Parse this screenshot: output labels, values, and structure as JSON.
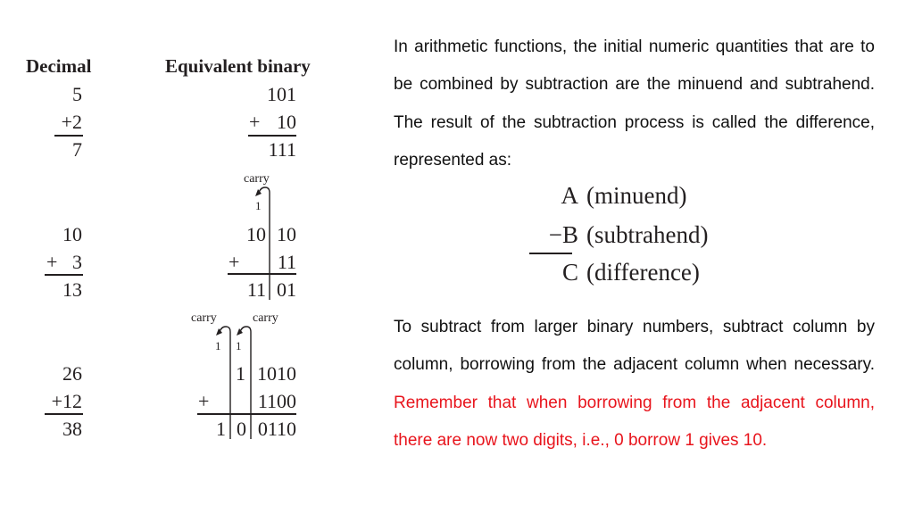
{
  "left_figure": {
    "headers": {
      "decimal": "Decimal",
      "binary": "Equivalent binary"
    },
    "examples": [
      {
        "decimal": {
          "a": "5",
          "b": "+2",
          "sum": "7"
        },
        "binary": {
          "a": "101",
          "op": "+",
          "b": "10",
          "sum": "111"
        }
      },
      {
        "decimal": {
          "a": "10",
          "op": "+",
          "b": "3",
          "sum": "13"
        },
        "binary": {
          "carry_label": "carry",
          "carry_digit": "1",
          "a_high": "10",
          "a_low": "10",
          "op": "+",
          "b_low": "11",
          "sum_high": "11",
          "sum_low": "01"
        }
      },
      {
        "decimal": {
          "a": "26",
          "b": "+12",
          "sum": "38"
        },
        "binary": {
          "carry_labels": [
            "carry",
            "carry"
          ],
          "carry_digits": [
            "1",
            "1"
          ],
          "a_mid": "1",
          "a_low": "1010",
          "op": "+",
          "b_low": "1100",
          "sum_high": "1",
          "sum_mid": "0",
          "sum_low": "0110"
        }
      }
    ]
  },
  "right_text": {
    "paragraph1": "In arithmetic functions, the initial numeric quantities that are to be combined by subtraction are the minuend and subtrahend. The result of the subtraction process is called the difference, represented as:",
    "equation": {
      "row1": {
        "symbol": "A",
        "label": "(minuend)"
      },
      "row2": {
        "symbol": "−B",
        "label": "(subtrahend)"
      },
      "row3": {
        "symbol": "C",
        "label": "(difference)"
      }
    },
    "paragraph2_black": "To subtract from larger binary numbers, subtract column by column, borrowing from the adjacent column when necessary.",
    "paragraph2_red": "Remember that when borrowing from the adjacent column, there are now two digits, i.e., 0 borrow 1 gives 10.",
    "highlight_color": "#e8141c"
  }
}
